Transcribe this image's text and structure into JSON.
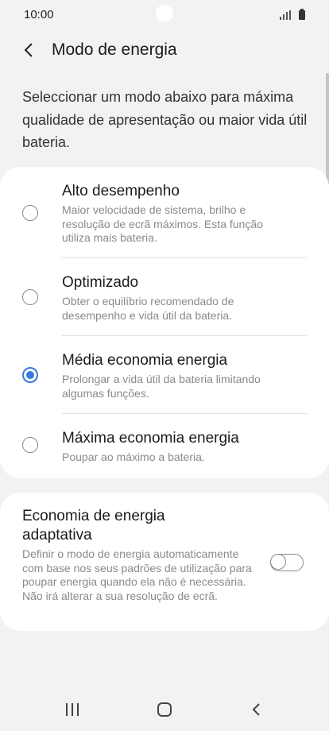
{
  "status_bar": {
    "time": "10:00"
  },
  "header": {
    "title": "Modo de energia"
  },
  "description": "Seleccionar um modo abaixo para máxima qualidade de apresentação ou maior vida útil bateria.",
  "modes": [
    {
      "title": "Alto desempenho",
      "description": "Maior velocidade de sistema, brilho e resolução de ecrã máximos. Esta função utiliza mais bateria.",
      "selected": false
    },
    {
      "title": "Optimizado",
      "description": "Obter o equilíbrio recomendado de desempenho e vida útil da bateria.",
      "selected": false
    },
    {
      "title": "Média economia energia",
      "description": "Prolongar a vida útil da bateria limitando algumas funções.",
      "selected": true
    },
    {
      "title": "Máxima economia energia",
      "description": "Poupar ao máximo a bateria.",
      "selected": false
    }
  ],
  "adaptive": {
    "title": "Economia de energia adaptativa",
    "description": "Definir o modo de energia automaticamente com base nos seus padrões de utilização para poupar energia quando ela não é necessária. Não irá alterar a sua resolução de ecrã.",
    "enabled": false
  },
  "colors": {
    "accent": "#3a78e2",
    "background": "#f2f2f2",
    "card": "#ffffff"
  },
  "icons": {
    "back": "back-arrow-icon",
    "recents": "recents-icon",
    "home": "home-icon",
    "nav_back": "nav-back-icon"
  }
}
